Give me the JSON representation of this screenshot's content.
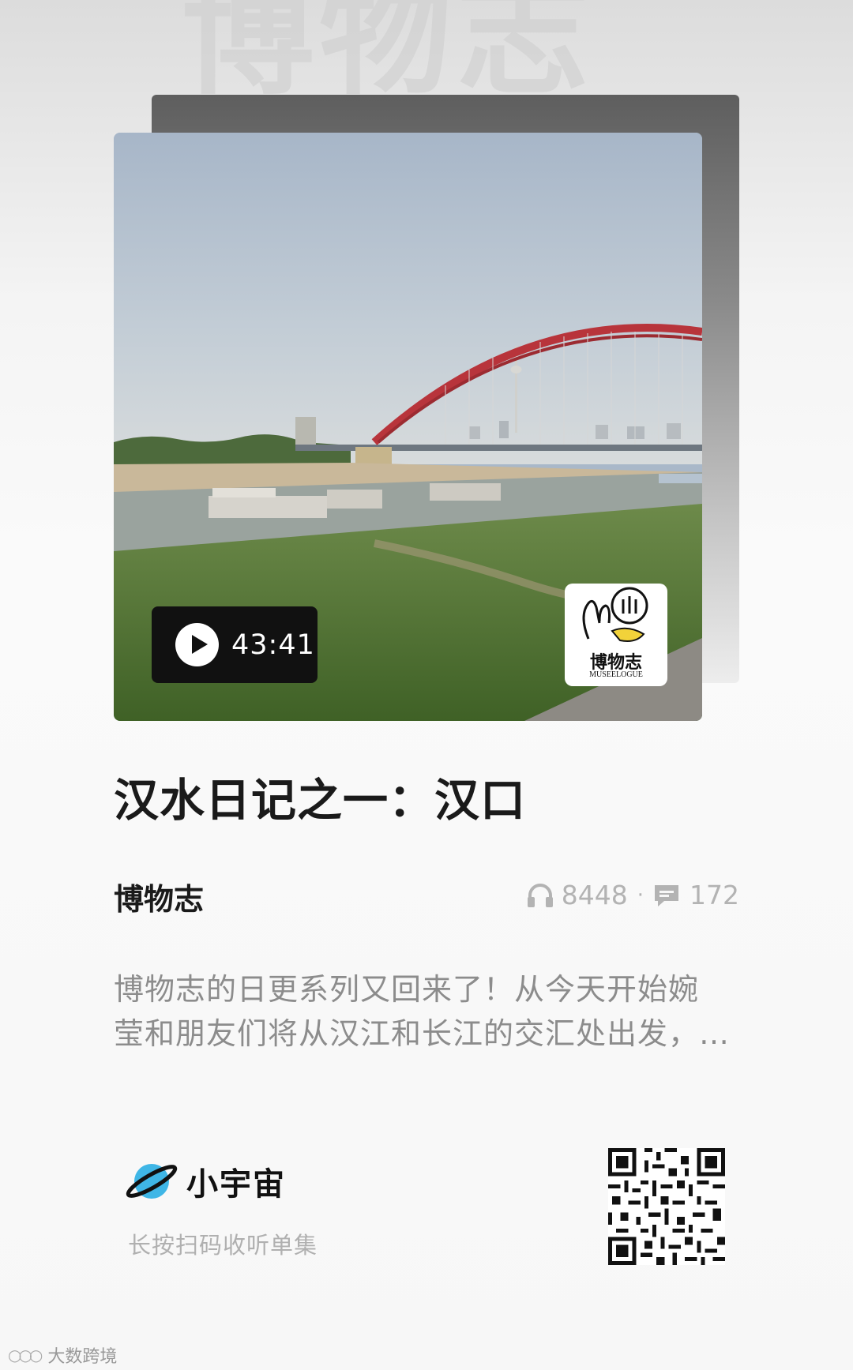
{
  "background": {
    "watermark_text": "博物志"
  },
  "episode": {
    "duration": "43:41",
    "title": "汉水日记之一：汉口",
    "badge_label": "博物志",
    "badge_sub": "MUSEELOGUE"
  },
  "podcast": {
    "name": "博物志",
    "plays": "8448",
    "separator": "·",
    "comments": "172"
  },
  "description": {
    "lines": [
      "博物志的日更系列又回来了！从今天开始婉",
      "莹和朋友们将从汉江和长江的交汇处出发，…"
    ]
  },
  "footer": {
    "brand": "小宇宙",
    "scan_hint": "长按扫码收听单集"
  },
  "corner_watermark": "大数跨境",
  "colors": {
    "title": "#1a1a1a",
    "muted": "#8c8c8c",
    "stats": "#b3b3b3",
    "brand_planet": "#3fb6e6",
    "bridge": "#b8343b"
  }
}
